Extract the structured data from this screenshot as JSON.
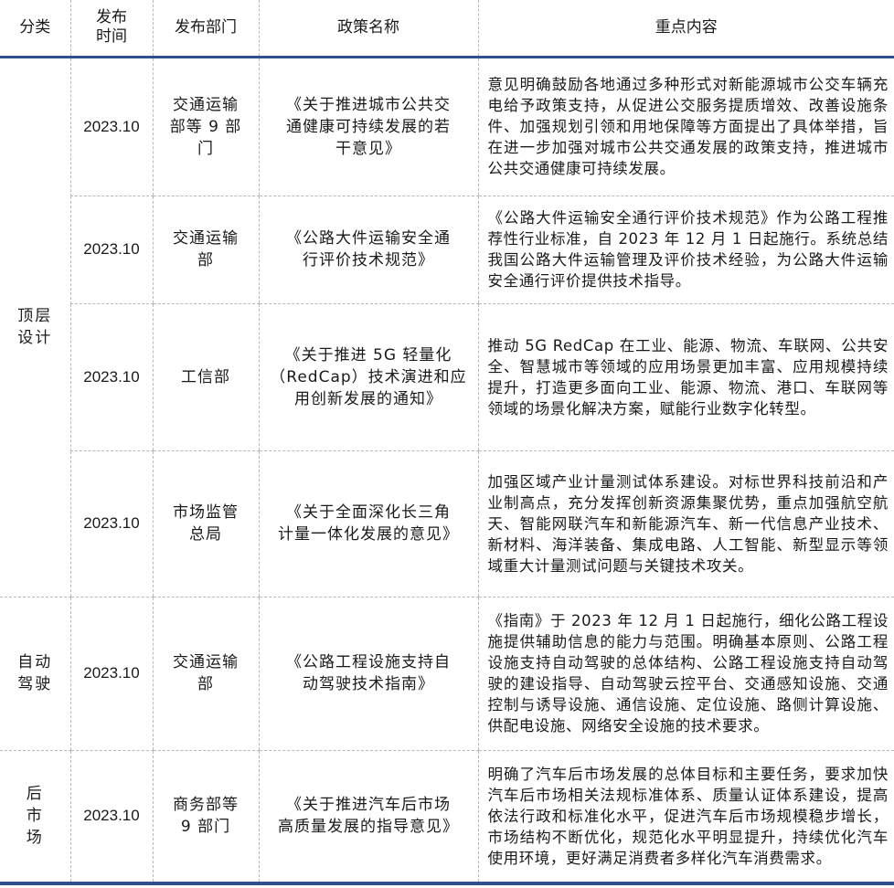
{
  "header": {
    "category": "分类",
    "time": "发布\n时间",
    "dept": "发布部门",
    "name": "政策名称",
    "content": "重点内容"
  },
  "rows": [
    {
      "category": "顶层\n设计",
      "time": "2023.10",
      "dept": "交通运输\n部等 9 部\n门",
      "name": "《关于推进城市公共交\n通健康可持续发展的若\n干意见》",
      "content": "意见明确鼓励各地通过多种形式对新能源城市公交车辆充电给予政策支持，从促进公交服务提质增效、改善设施条件、加强规划引领和用地保障等方面提出了具体举措，旨在进一步加强对城市公共交通发展的政策支持，推进城市公共交通健康可持续发展。"
    },
    {
      "time": "2023.10",
      "dept": "交通运输\n部",
      "name": "《公路大件运输安全通\n行评价技术规范》",
      "content": "《公路大件运输安全通行评价技术规范》作为公路工程推荐性行业标准，自 2023 年 12 月 1 日起施行。系统总结我国公路大件运输管理及评价技术经验，为公路大件运输安全通行评价提供技术指导。"
    },
    {
      "time": "2023.10",
      "dept": "工信部",
      "name": "《关于推进 5G 轻量化\n（RedCap）技术演进和应\n用创新发展的通知》",
      "content": "推动 5G RedCap 在工业、能源、物流、车联网、公共安全、智慧城市等领域的应用场景更加丰富、应用规模持续提升，打造更多面向工业、能源、物流、港口、车联网等领域的场景化解决方案，赋能行业数字化转型。"
    },
    {
      "time": "2023.10",
      "dept": "市场监管\n总局",
      "name": "《关于全面深化长三角\n计量一体化发展的意见》",
      "content": "加强区域产业计量测试体系建设。对标世界科技前沿和产业制高点，充分发挥创新资源集聚优势，重点加强航空航天、智能网联汽车和新能源汽车、新一代信息产业技术、新材料、海洋装备、集成电路、人工智能、新型显示等领域重大计量测试问题与关键技术攻关。"
    },
    {
      "category": "自动\n驾驶",
      "time": "2023.10",
      "dept": "交通运输\n部",
      "name": "《公路工程设施支持自\n动驾驶技术指南》",
      "content": "《指南》于 2023 年 12 月 1 日起施行，细化公路工程设施提供辅助信息的能力与范围。明确基本原则、公路工程设施支持自动驾驶的总体结构、公路工程设施支持自动驾驶的建设指导、自动驾驶云控平台、交通感知设施、交通控制与诱导设施、通信设施、定位设施、路侧计算设施、供配电设施、网络安全设施的技术要求。"
    },
    {
      "category": "后\n市\n场",
      "time": "2023.10",
      "dept": "商务部等\n9 部门",
      "name": "《关于推进汽车后市场\n高质量发展的指导意见》",
      "content": "明确了汽车后市场发展的总体目标和主要任务，要求加快汽车后市场相关法规标准体系、质量认证体系建设，提高依法行政和标准化水平，促进汽车后市场规模稳步增长，市场结构不断优化，规范化水平明显提升，持续优化汽车使用环境，更好满足消费者多样化汽车消费需求。"
    }
  ]
}
